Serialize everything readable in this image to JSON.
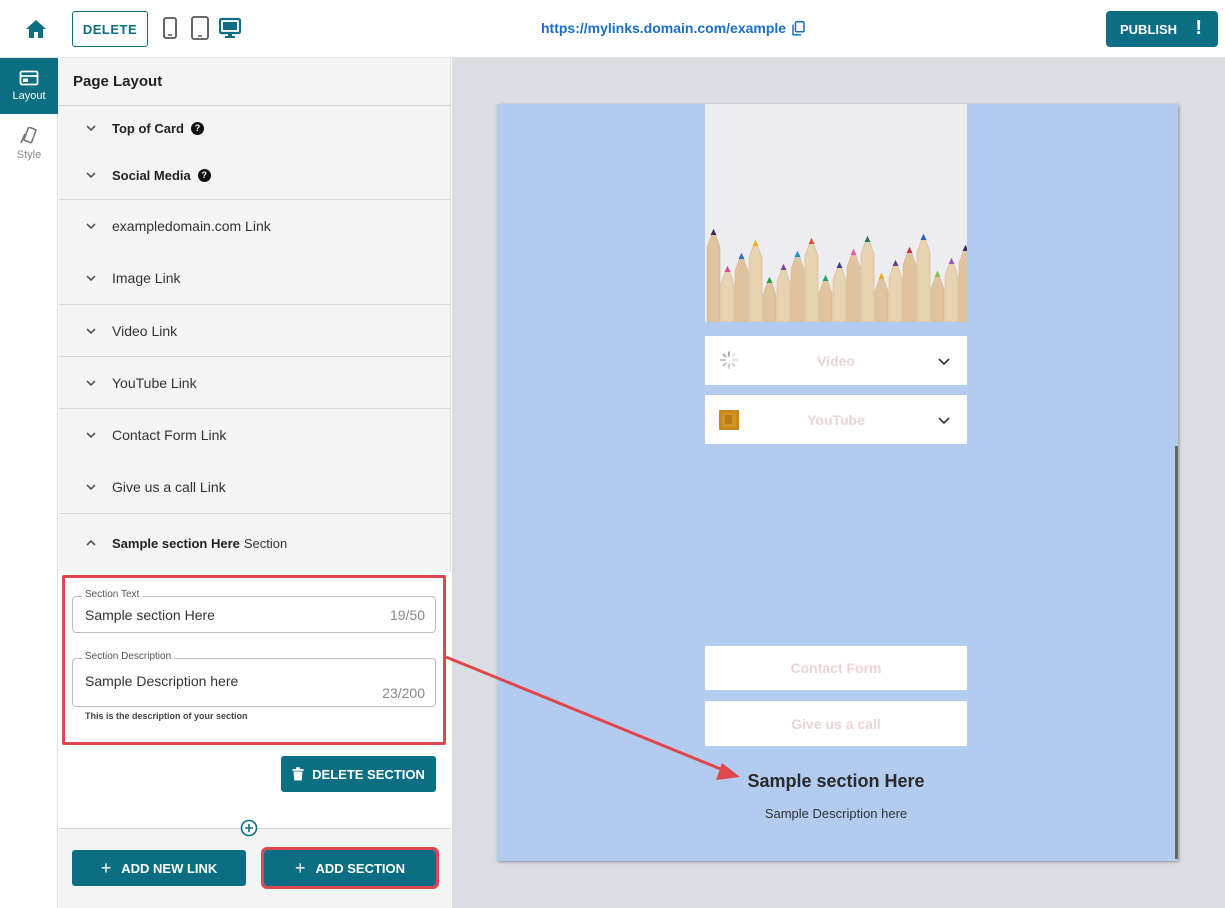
{
  "topbar": {
    "delete_label": "DELETE",
    "url": "https://mylinks.domain.com/example",
    "publish_label": "PUBLISH",
    "publish_alert": "!"
  },
  "rail": {
    "items": [
      {
        "label": "Layout",
        "icon": "layout-icon",
        "active": true
      },
      {
        "label": "Style",
        "icon": "style-icon",
        "active": false
      }
    ]
  },
  "panel": {
    "title": "Page Layout",
    "items": [
      {
        "label": "Top of Card",
        "help": true
      },
      {
        "label": "Social Media",
        "help": true
      },
      {
        "label": "exampledomain.com Link"
      },
      {
        "label": "Image Link"
      },
      {
        "label": "Video Link"
      },
      {
        "label": "YouTube Link"
      },
      {
        "label": "Contact Form Link"
      },
      {
        "label": "Give us a call Link"
      }
    ],
    "section": {
      "name": "Sample section Here",
      "suffix": "Section",
      "text_label": "Section Text",
      "text_value": "Sample section Here",
      "text_count": "19/50",
      "desc_label": "Section Description",
      "desc_value": "Sample Description here",
      "desc_count": "23/200",
      "hint": "This is the description of your section",
      "delete_label": "DELETE SECTION"
    },
    "add_link_label": "ADD NEW LINK",
    "add_section_label": "ADD SECTION"
  },
  "preview": {
    "links": [
      {
        "label": "Video",
        "thumb": "spinner-icon",
        "dropdown": true
      },
      {
        "label": "YouTube",
        "thumb": "youtube-thumbnail",
        "dropdown": true
      },
      {
        "label": "Contact Form",
        "dropdown": false
      },
      {
        "label": "Give us a call",
        "dropdown": false
      }
    ],
    "section_title": "Sample section Here",
    "section_desc": "Sample Description here"
  },
  "colors": {
    "accent": "#0b6e82",
    "link": "#1b6fc7",
    "card_bg": "#b3cbef",
    "highlight": "#e0474c",
    "preview_bg": "#dadee2"
  }
}
